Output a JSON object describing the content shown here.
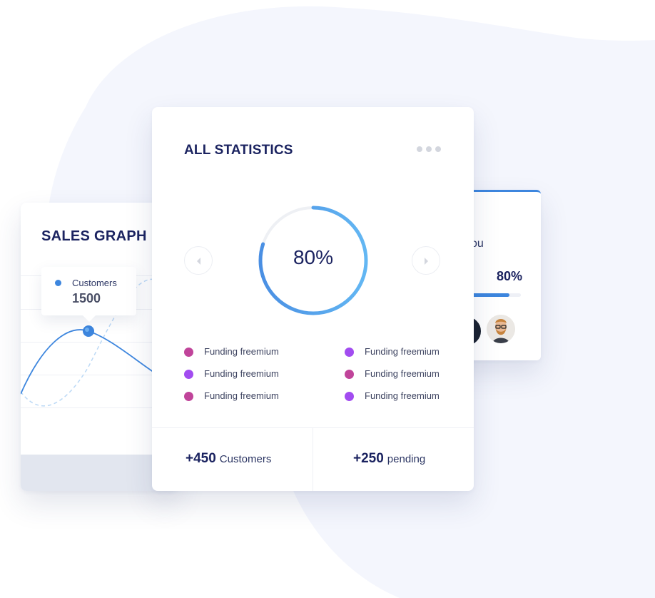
{
  "team_card": {
    "partial_text": "ou",
    "percent_label": "80%",
    "progress": 0.8
  },
  "sales_graph": {
    "title": "SALES GRAPH",
    "tooltip": {
      "label": "Customers",
      "value": "1500"
    }
  },
  "statistics": {
    "title": "ALL STATISTICS",
    "progress_percent": 80,
    "progress_label": "80%",
    "legend": [
      {
        "label": "Funding freemium",
        "color": "#c0449a"
      },
      {
        "label": "Funding freemium",
        "color": "#a24cf0"
      },
      {
        "label": "Funding freemium",
        "color": "#a24cf0"
      },
      {
        "label": "Funding freemium",
        "color": "#c0449a"
      },
      {
        "label": "Funding freemium",
        "color": "#c0449a"
      },
      {
        "label": "Funding freemium",
        "color": "#a24cf0"
      }
    ],
    "footer": [
      {
        "value": "+450",
        "label": "Customers"
      },
      {
        "value": "+250",
        "label": "pending"
      }
    ]
  },
  "colors": {
    "accent_blue": "#3d86de",
    "navy_text": "#1b2360",
    "background_blob": "#f4f6fd"
  }
}
